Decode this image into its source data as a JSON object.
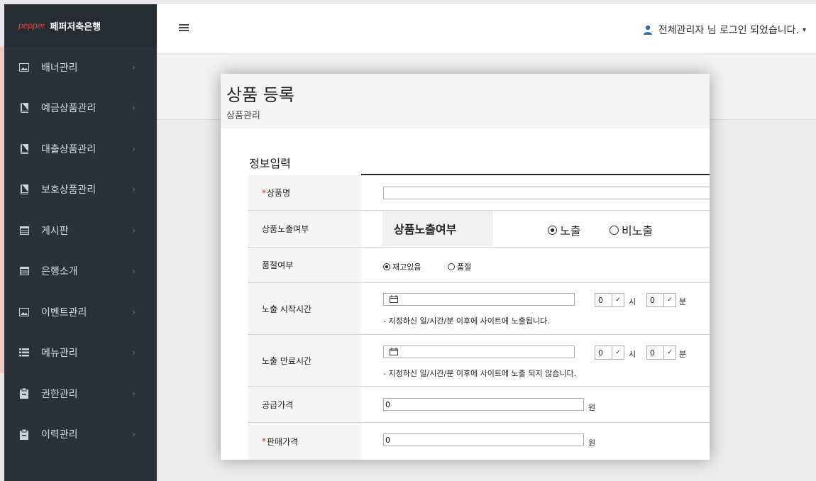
{
  "brand": {
    "logo": "pepper",
    "name": "페퍼저축은행"
  },
  "sidebar": {
    "items": [
      {
        "label": "배너관리",
        "icon": "image-icon"
      },
      {
        "label": "예금상품관리",
        "icon": "book-icon"
      },
      {
        "label": "대출상품관리",
        "icon": "book-icon"
      },
      {
        "label": "보호상품관리",
        "icon": "book-icon"
      },
      {
        "label": "게시판",
        "icon": "table-icon"
      },
      {
        "label": "은행소개",
        "icon": "table-icon"
      },
      {
        "label": "이벤트관리",
        "icon": "image-icon"
      },
      {
        "label": "메뉴관리",
        "icon": "list-icon"
      },
      {
        "label": "권한관리",
        "icon": "clipboard-icon"
      },
      {
        "label": "이력관리",
        "icon": "clipboard-icon"
      }
    ],
    "chevron": "›"
  },
  "topbar": {
    "user_text": "전체관리자 님 로그인 되었습니다.",
    "caret": "▾"
  },
  "page": {
    "title": "상품 등록",
    "subtitle": "상품관리"
  },
  "form": {
    "section_title": "정보입력",
    "required_mark": "*",
    "product_name": {
      "label": "상품명",
      "value": ""
    },
    "exposure": {
      "label": "상품노출여부",
      "tooltip": "상품노출여부",
      "options": [
        "노출",
        "비노출"
      ],
      "selected": "노출"
    },
    "soldout": {
      "label": "품절여부",
      "options": [
        "재고있음",
        "품절"
      ],
      "selected": "재고있음"
    },
    "start_time": {
      "label": "노출 시작시간",
      "date": "",
      "hour": "0",
      "minute": "0",
      "hour_unit": "시",
      "minute_unit": "분",
      "note": "- 지정하신 일/시간/분 이후에 사이트에 노출됩니다."
    },
    "end_time": {
      "label": "노출 만료시간",
      "date": "",
      "hour": "0",
      "minute": "0",
      "hour_unit": "시",
      "minute_unit": "분",
      "note": "- 지정하신 일/시간/분 이후에 사이트에 노출 되지 않습니다."
    },
    "supply_price": {
      "label": "공급가격",
      "value": "0",
      "unit": "원"
    },
    "sale_price": {
      "label": "판매가격",
      "value": "0",
      "unit": "원"
    }
  }
}
